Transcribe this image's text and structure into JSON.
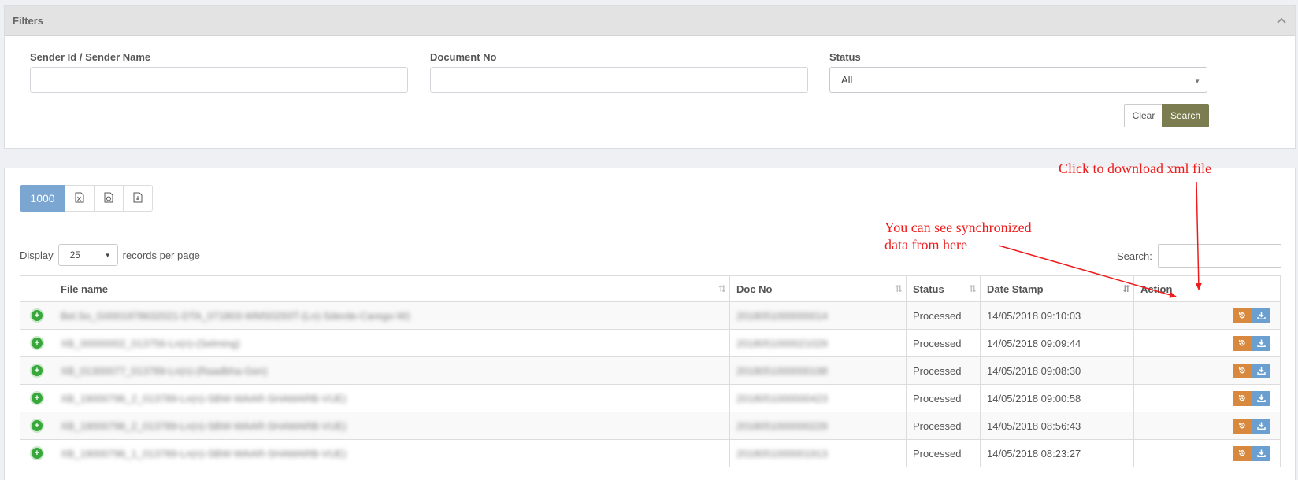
{
  "filters": {
    "title": "Filters",
    "sender_label": "Sender Id / Sender Name",
    "docno_label": "Document No",
    "status_label": "Status",
    "status_value": "All",
    "clear_label": "Clear",
    "search_label": "Search"
  },
  "toolbar": {
    "records_button": "1000",
    "export_icons": [
      "excel-icon",
      "csv-icon",
      "pdf-icon"
    ]
  },
  "table_controls": {
    "display_label": "Display",
    "page_length": "25",
    "records_per_page": "records per page",
    "search_label": "Search:"
  },
  "table": {
    "headers": [
      "File name",
      "Doc No",
      "Status",
      "Date Stamp",
      "Action"
    ],
    "rows": [
      {
        "file": "Bel.So_G0001978632021-DTA_071803-WMS0293T-(Ln)-Sderde-Carego-W)",
        "doc": "2018051000000014",
        "status": "Processed",
        "date": "14/05/2018 09:10:03"
      },
      {
        "file": "XB_00000002_013756-Ln(n)-(Selming)",
        "doc": "2018051000021029",
        "status": "Processed",
        "date": "14/05/2018 09:09:44"
      },
      {
        "file": "XB_01300077_013789-Ln(n)-(Raadbha-Gen)",
        "doc": "2018051000000198",
        "status": "Processed",
        "date": "14/05/2018 09:08:30"
      },
      {
        "file": "XB_19000796_2_013789-Ln(n)-SBW-WAAR-SHAMARB-VUE)",
        "doc": "2018051000000423",
        "status": "Processed",
        "date": "14/05/2018 09:00:58"
      },
      {
        "file": "XB_19000796_2_013789-Ln(n)-SBW-WAAR-SHAMARB-VUE)",
        "doc": "2018051000000229",
        "status": "Processed",
        "date": "14/05/2018 08:56:43"
      },
      {
        "file": "XB_19000796_1_013789-Ln(n)-SBW-WAAR-SHAMARB-VUE)",
        "doc": "2018051000001913",
        "status": "Processed",
        "date": "14/05/2018 08:23:27"
      }
    ]
  },
  "annotations": {
    "download_note": "Click to download xml file",
    "sync_note_line1": "You can see synchronized",
    "sync_note_line2": "data from here",
    "color": "#ee1c1c"
  },
  "colors": {
    "search_button": "#7b7c50",
    "records_button": "#7aa6d1",
    "sync_button": "#d9893d",
    "download_button": "#6b9fd0",
    "expand_icon": "#39a83c"
  }
}
